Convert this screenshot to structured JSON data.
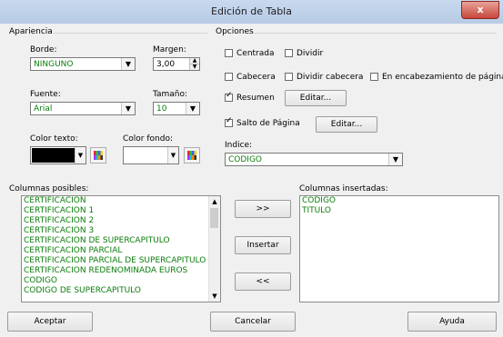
{
  "window": {
    "title": "Edición de Tabla",
    "close_glyph": "x"
  },
  "apariencia": {
    "heading": "Apariencia",
    "borde_label": "Borde:",
    "borde_value": "NINGUNO",
    "margen_label": "Margen:",
    "margen_value": "3,00",
    "fuente_label": "Fuente:",
    "fuente_value": "Arial",
    "tamano_label": "Tamaño:",
    "tamano_value": "10",
    "color_texto_label": "Color texto:",
    "color_fondo_label": "Color fondo:",
    "color_texto": "#000000",
    "color_fondo": "#ffffff"
  },
  "opciones": {
    "heading": "Opciones",
    "centrada": {
      "label": "Centrada",
      "checked": false
    },
    "dividir": {
      "label": "Dividir",
      "checked": false
    },
    "cabecera": {
      "label": "Cabecera",
      "checked": false
    },
    "dividir_cabecera": {
      "label": "Dividir cabecera",
      "checked": false
    },
    "encabezamiento": {
      "label": "En encabezamiento de página",
      "checked": false
    },
    "resumen": {
      "label": "Resumen",
      "checked": true
    },
    "salto": {
      "label": "Salto de Página",
      "checked": true
    },
    "editar1": "Editar...",
    "editar2": "Editar...",
    "indice_label": "Indice:",
    "indice_value": "CODIGO"
  },
  "columnas_posibles": {
    "label": "Columnas posibles:",
    "items": [
      "CERTIFICACION",
      "CERTIFICACION 1",
      "CERTIFICACION 2",
      "CERTIFICACION 3",
      "CERTIFICACION DE SUPERCAPITULO",
      "CERTIFICACION PARCIAL",
      "CERTIFICACION PARCIAL DE SUPERCAPITULO",
      "CERTIFICACION REDENOMINADA EUROS",
      "CODIGO",
      "CODIGO DE SUPERCAPITULO"
    ]
  },
  "columnas_insertadas": {
    "label": "Columnas insertadas:",
    "items": [
      "CODIGO",
      "TITULO"
    ]
  },
  "middle_buttons": {
    "add_all": ">>",
    "insertar": "Insertar",
    "remove_all": "<<"
  },
  "footer": {
    "aceptar": "Aceptar",
    "cancelar": "Cancelar",
    "ayuda": "Ayuda"
  }
}
